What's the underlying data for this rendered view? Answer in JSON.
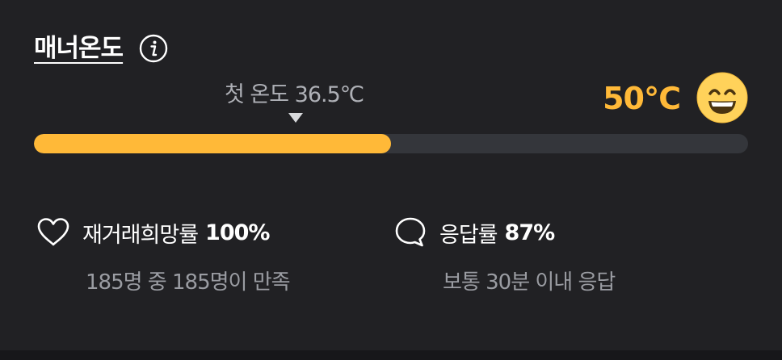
{
  "manner": {
    "title": "매너온도",
    "info_icon": "info-icon",
    "first_temp_label": "첫 온도 36.5℃",
    "current_temp": "50℃",
    "temp_icon": "smiley-face-icon",
    "progress_fraction": 0.5,
    "colors": {
      "accent": "#ffb938",
      "track": "#34363b",
      "background": "#212124"
    }
  },
  "stats": {
    "rebuy": {
      "icon": "heart-icon",
      "label": "재거래희망률",
      "value": "100%",
      "sub": "185명 중 185명이 만족"
    },
    "response": {
      "icon": "speech-bubble-icon",
      "label": "응답률",
      "value": "87%",
      "sub": "보통 30분 이내 응답"
    }
  }
}
